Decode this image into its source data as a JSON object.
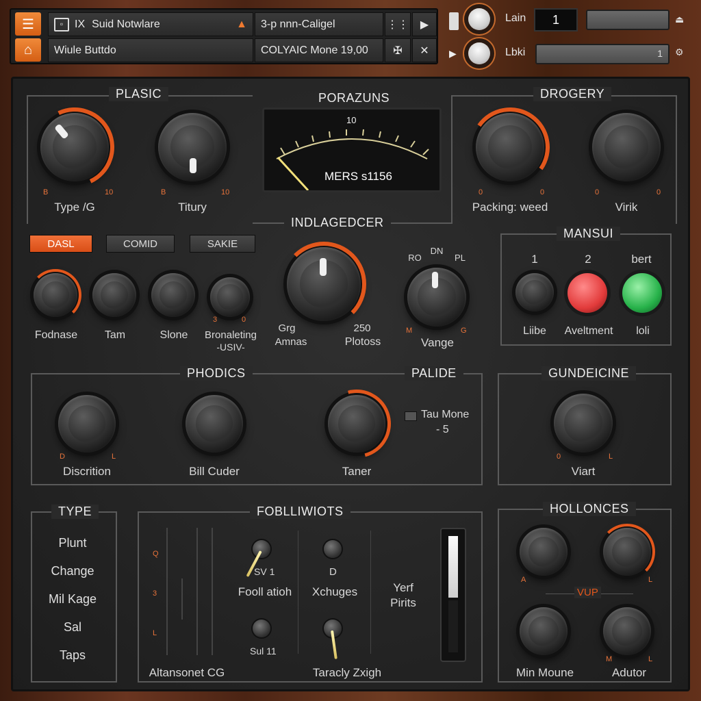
{
  "header": {
    "row1": {
      "app_label": "IX",
      "title": "Suid Notwlare",
      "field": "3-p nnn-Caligel"
    },
    "row2": {
      "title": "Wiule Buttdo",
      "field": "COLYAIC Mone 19,00"
    },
    "controls": {
      "top_label": "Lain",
      "top_value": "1",
      "bottom_label": "Lbki",
      "bottom_meter": "1"
    }
  },
  "sections": {
    "plasic": {
      "title": "PLASIC",
      "knob1": "Type /G",
      "knob2": "Titury",
      "ticks": [
        "B",
        "10",
        "B",
        "10"
      ]
    },
    "porazuns": {
      "title": "PORAZUNS",
      "scale_value": "10",
      "readout": "MERS s1156"
    },
    "drogery": {
      "title": "DROGERY",
      "knob1": "Packing: weed",
      "knob2": "Virik",
      "ticks": [
        "0",
        "0",
        "0",
        "0"
      ]
    },
    "modes": {
      "buttons": [
        "DASL",
        "COMID",
        "SAKIE"
      ],
      "selected": "DASL"
    },
    "small_knobs": [
      "Fodnase",
      "Tam",
      "Slone",
      "Bronaleting",
      "-USIV-"
    ],
    "small_ticks": [
      "3",
      "0"
    ],
    "indlagedcer": {
      "title": "INDLAGEDCER",
      "left1": "Grg",
      "left2": "Amnas",
      "right1": "250",
      "right2": "Plotoss"
    },
    "vange": {
      "label": "Vange",
      "top": [
        "RO",
        "DN",
        "PL"
      ],
      "ticks": [
        "M",
        "G"
      ]
    },
    "mansui": {
      "title": "MANSUI",
      "cols": [
        "1",
        "2",
        "bert"
      ],
      "labels": [
        "Liibe",
        "Aveltment",
        "loli"
      ]
    },
    "phodics": {
      "title": "PHODICS",
      "knobs": [
        "Discrition",
        "Bill Cuder",
        "Taner"
      ],
      "ticks": [
        "D",
        "L"
      ]
    },
    "palide": {
      "title": "PALIDE",
      "option": "Tau Mone",
      "value": "- 5"
    },
    "gundeicine": {
      "title": "GUNDEICINE",
      "knob": "Viart",
      "ticks": [
        "0",
        "L"
      ]
    },
    "type": {
      "title": "TYPE",
      "items": [
        "Plunt",
        "Change",
        "Mil Kage",
        "Sal",
        "Taps"
      ]
    },
    "fobbliwiots": {
      "title": "FOBLLIWIOTS",
      "fader_marks": [
        "Q",
        "3",
        "L"
      ],
      "toggles": [
        "SV 1",
        "D",
        "Sul 11"
      ],
      "toggle_labels": [
        "Fooll atioh",
        "Xchuges"
      ],
      "center_text": [
        "Yerf",
        "Pirits"
      ],
      "bottom": [
        "Altansonet CG",
        "Taracly Zxigh"
      ]
    },
    "hollonces": {
      "title": "HOLLONCES",
      "mid": "VUP",
      "bottom": [
        "Min Moune",
        "Adutor"
      ],
      "ticks": [
        "A",
        "L",
        "M",
        "L"
      ]
    }
  }
}
